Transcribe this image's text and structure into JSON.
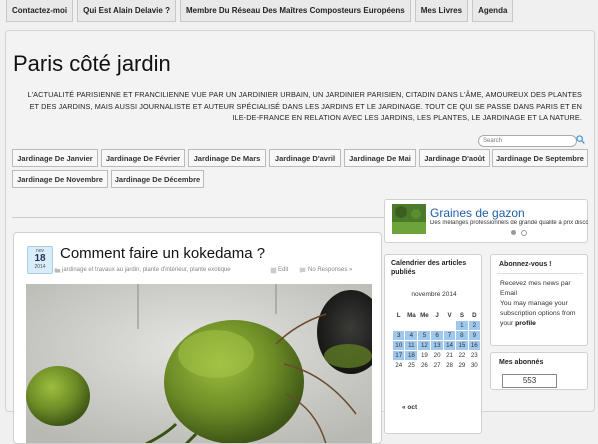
{
  "top_nav": [
    "Contactez-moi",
    "Qui Est Alain Delavie ?",
    "Membre Du Réseau Des Maîtres Composteurs Européens",
    "Mes Livres",
    "Agenda"
  ],
  "site": {
    "title": "Paris côté jardin",
    "tagline": "L'ACTUALITÉ PARISIENNE ET FRANCILIENNE VUE PAR UN JARDINIER URBAIN, UN JARDINIER PARISIEN, CITADIN DANS L'ÂME, AMOUREUX DES PLANTES ET DES JARDINS, MAIS AUSSI JOURNALISTE ET AUTEUR SPÉCIALISÉ DANS LES JARDINS ET LE JARDINAGE. TOUT CE QUI SE PASSE DANS PARIS ET EN ILE-DE-FRANCE EN RELATION AVEC LES JARDINS, LES PLANTES, LE JARDINAGE ET LA NATURE."
  },
  "search": {
    "placeholder": "Search"
  },
  "month_nav": [
    "Jardinage De Janvier",
    "Jardinage De Février",
    "Jardinage De Mars",
    "Jardinage D'avril",
    "Jardinage De Mai",
    "Jardinage D'août",
    "Jardinage De Septembre",
    "Jardinage De Novembre",
    "Jardinage De Décembre"
  ],
  "post": {
    "date": {
      "month": "nov",
      "day": "18",
      "year": "2014"
    },
    "title": "Comment faire un kokedama ?",
    "categories": "jardinage et travaux au jardin, plante d'intérieur, plante exotique",
    "edit": "Edit",
    "responses": "No Responses »"
  },
  "slider": {
    "title": "Graines de gazon",
    "subtitle": "Des mélanges professionnels de grande qualité à prix discount"
  },
  "calendar": {
    "title": "Calendrier des articles publiés",
    "month": "novembre 2014",
    "headers": [
      "L",
      "Ma",
      "Me",
      "J",
      "V",
      "S",
      "D"
    ],
    "rows": [
      [
        "",
        "",
        "",
        "",
        "",
        "1",
        "2"
      ],
      [
        "3",
        "4",
        "5",
        "6",
        "7",
        "8",
        "9"
      ],
      [
        "10",
        "11",
        "12",
        "13",
        "14",
        "15",
        "16"
      ],
      [
        "17",
        "18",
        "19",
        "20",
        "21",
        "22",
        "23"
      ],
      [
        "24",
        "25",
        "26",
        "27",
        "28",
        "29",
        "30"
      ]
    ],
    "prev": "« oct"
  },
  "subscribe": {
    "title": "Abonnez-vous !",
    "text": "Recevez mes news par Email",
    "text2": "You may manage your subscription options from your",
    "link": "profile"
  },
  "subscribers": {
    "title": "Mes abonnés",
    "count": "553"
  },
  "colors": {
    "accent": "#1f5fa8",
    "highlight": "#9fc8ec",
    "badge": "#d9ecfa"
  }
}
